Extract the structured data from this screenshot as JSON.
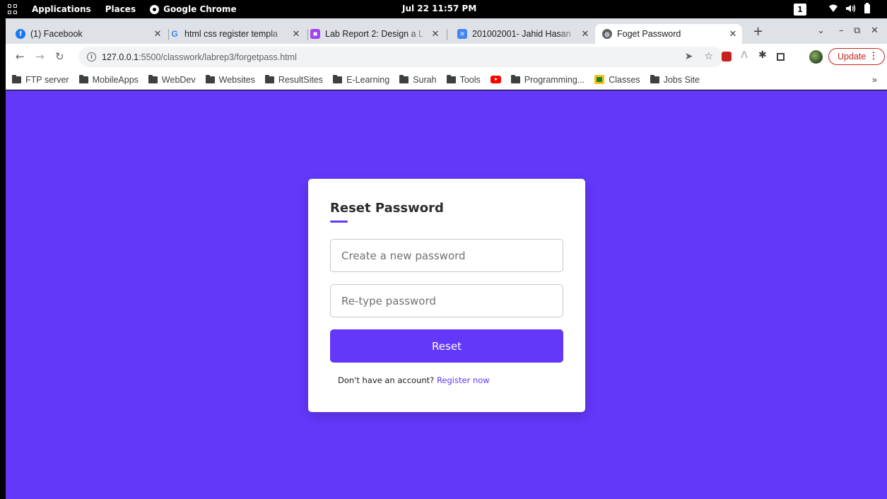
{
  "topbar": {
    "applications": "Applications",
    "places": "Places",
    "app_name": "Google Chrome",
    "clock": "Jul 22  11:57 PM",
    "workspace": "1"
  },
  "tabs": [
    {
      "label": "(1) Facebook",
      "icon": "facebook-icon",
      "color": "#1877f2"
    },
    {
      "label": "html css register templa",
      "icon": "google-icon",
      "color": "#4285f4"
    },
    {
      "label": "Lab Report 2: Design a L",
      "icon": "classroom-icon",
      "color": "#a142f4"
    },
    {
      "label": "201002001- Jahid Hasan",
      "icon": "docs-icon",
      "color": "#4285f4"
    },
    {
      "label": "Foget Password",
      "icon": "globe-icon",
      "color": "#5f6368",
      "active": true
    }
  ],
  "toolbar": {
    "url_host": "127.0.0.1",
    "url_path": ":5500/classwork/labrep3/forgetpass.html",
    "update_label": "Update"
  },
  "bookmarks": [
    {
      "label": "FTP server",
      "icon": "folder-icon"
    },
    {
      "label": "MobileApps",
      "icon": "folder-icon"
    },
    {
      "label": "WebDev",
      "icon": "folder-icon"
    },
    {
      "label": "Websites",
      "icon": "folder-icon"
    },
    {
      "label": "ResultSites",
      "icon": "folder-icon"
    },
    {
      "label": "E-Learning",
      "icon": "folder-icon"
    },
    {
      "label": "Surah",
      "icon": "folder-icon"
    },
    {
      "label": "Tools",
      "icon": "folder-icon"
    },
    {
      "label": "",
      "icon": "youtube-icon"
    },
    {
      "label": "Programming...",
      "icon": "folder-icon"
    },
    {
      "label": "Classes",
      "icon": "classes-icon"
    },
    {
      "label": "Jobs Site",
      "icon": "folder-icon"
    }
  ],
  "form": {
    "title": "Reset Password",
    "new_password_placeholder": "Create a new password",
    "retype_placeholder": "Re-type password",
    "submit_label": "Reset",
    "prompt": "Don't have an account?",
    "link": "Register now"
  },
  "colors": {
    "accent": "#6338fb",
    "page_bg": "#6338fb",
    "update_red": "#c5221f"
  }
}
